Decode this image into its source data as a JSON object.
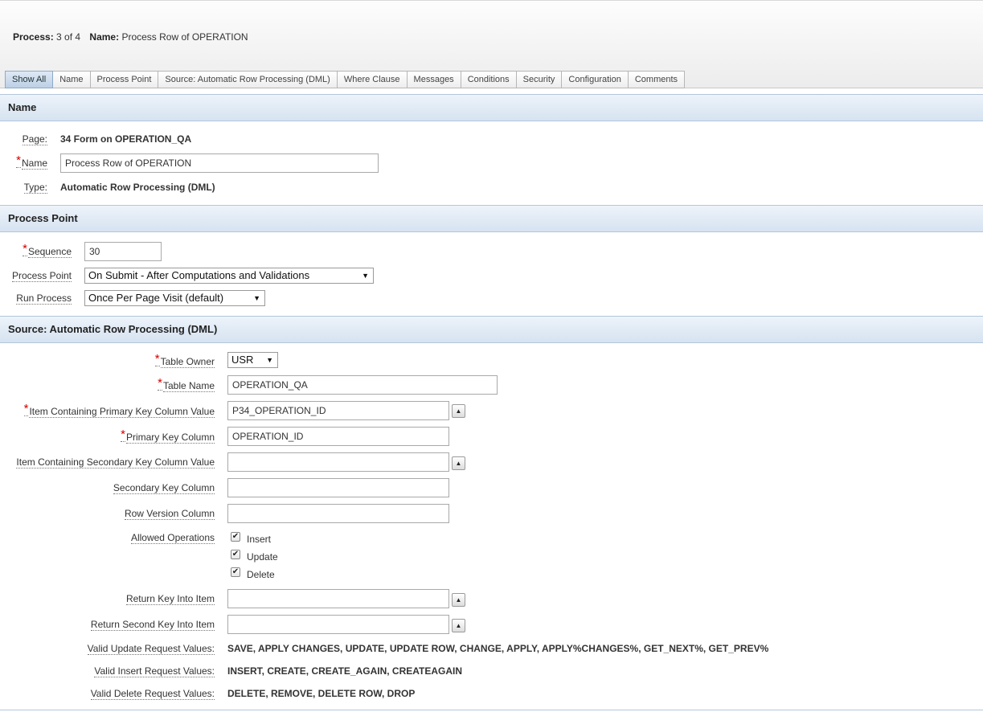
{
  "header": {
    "process_label": "Process:",
    "process_value": "3 of 4",
    "name_label": "Name:",
    "name_value": "Process Row of OPERATION"
  },
  "tabs": [
    {
      "label": "Show All",
      "active": true
    },
    {
      "label": "Name"
    },
    {
      "label": "Process Point"
    },
    {
      "label": "Source: Automatic Row Processing (DML)"
    },
    {
      "label": "Where Clause"
    },
    {
      "label": "Messages"
    },
    {
      "label": "Conditions"
    },
    {
      "label": "Security"
    },
    {
      "label": "Configuration"
    },
    {
      "label": "Comments"
    }
  ],
  "name_section": {
    "title": "Name",
    "page_label": "Page:",
    "page_value": "34 Form on OPERATION_QA",
    "name_label": "Name",
    "name_value": "Process Row of OPERATION",
    "type_label": "Type:",
    "type_value": "Automatic Row Processing (DML)"
  },
  "process_point_section": {
    "title": "Process Point",
    "sequence_label": "Sequence",
    "sequence_value": "30",
    "process_point_label": "Process Point",
    "process_point_value": "On Submit - After Computations and Validations",
    "run_process_label": "Run Process",
    "run_process_value": "Once Per Page Visit (default)"
  },
  "source_section": {
    "title": "Source: Automatic Row Processing (DML)",
    "table_owner_label": "Table Owner",
    "table_owner_value": "USR",
    "table_name_label": "Table Name",
    "table_name_value": "OPERATION_QA",
    "pk_item_label": "Item Containing Primary Key Column Value",
    "pk_item_value": "P34_OPERATION_ID",
    "pk_column_label": "Primary Key Column",
    "pk_column_value": "OPERATION_ID",
    "sk_item_label": "Item Containing Secondary Key Column Value",
    "sk_item_value": "",
    "sk_column_label": "Secondary Key Column",
    "sk_column_value": "",
    "row_version_label": "Row Version Column",
    "row_version_value": "",
    "allowed_ops_label": "Allowed Operations",
    "ops": [
      {
        "label": "Insert",
        "checked": true
      },
      {
        "label": "Update",
        "checked": true
      },
      {
        "label": "Delete",
        "checked": true
      }
    ],
    "return_key_label": "Return Key Into Item",
    "return_key_value": "",
    "return_second_key_label": "Return Second Key Into Item",
    "return_second_key_value": "",
    "valid_update_label": "Valid Update Request Values:",
    "valid_update_value": "SAVE, APPLY CHANGES, UPDATE, UPDATE ROW, CHANGE, APPLY, APPLY%CHANGES%, GET_NEXT%, GET_PREV%",
    "valid_insert_label": "Valid Insert Request Values:",
    "valid_insert_value": "INSERT, CREATE, CREATE_AGAIN, CREATEAGAIN",
    "valid_delete_label": "Valid Delete Request Values:",
    "valid_delete_value": "DELETE, REMOVE, DELETE ROW, DROP"
  },
  "icons": {
    "popup": "up-chevron-icon",
    "dropdown": "triangle-down-icon",
    "check": "check-icon",
    "required": "asterisk-icon"
  },
  "colors": {
    "section_header_bg": "#dbe6f3",
    "required_marker": "#d00000",
    "active_tab_bg": "#c9d9ec"
  }
}
